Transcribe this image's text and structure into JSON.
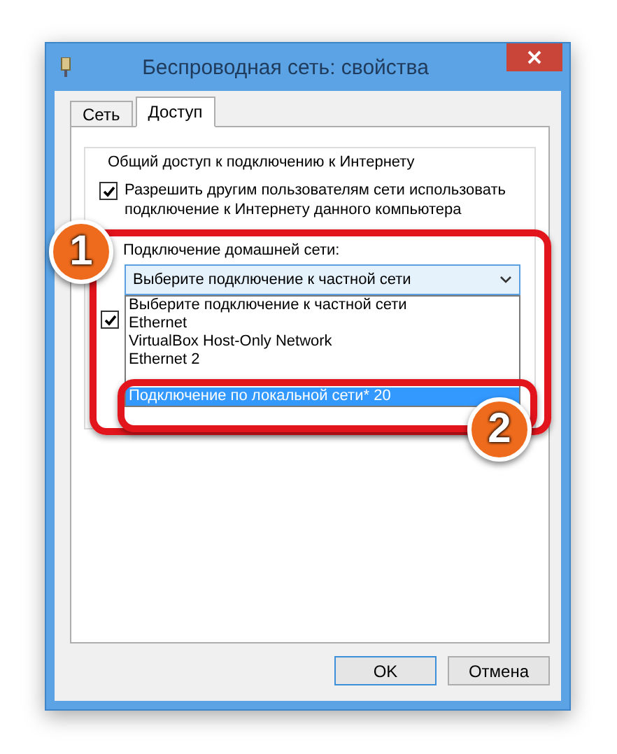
{
  "window": {
    "title": "Беспроводная сеть: свойства"
  },
  "tabs": [
    {
      "label": "Сеть",
      "selected": false
    },
    {
      "label": "Доступ",
      "selected": true
    }
  ],
  "group": {
    "title": "Общий доступ к подключению к Интернету",
    "share_checkbox": {
      "label": "Разрешить другим пользователям сети использовать подключение к Интернету данного компьютера",
      "checked": true
    },
    "home_network": {
      "label": "Подключение домашней сети:",
      "value": "Выберите подключение к частной сети",
      "expanded": true,
      "options": [
        {
          "label": "Выберите подключение к частной сети",
          "highlighted": false
        },
        {
          "label": "Ethernet",
          "highlighted": false
        },
        {
          "label": "VirtualBox Host-Only Network",
          "highlighted": false
        },
        {
          "label": "Ethernet 2",
          "highlighted": false
        },
        {
          "label": "Подключение по локальной сети* 20",
          "highlighted": true
        }
      ]
    },
    "second_checkbox": {
      "checked": true
    }
  },
  "buttons": [
    "OK",
    "Отмена"
  ],
  "annotations": [
    {
      "label": "1"
    },
    {
      "label": "2"
    }
  ]
}
